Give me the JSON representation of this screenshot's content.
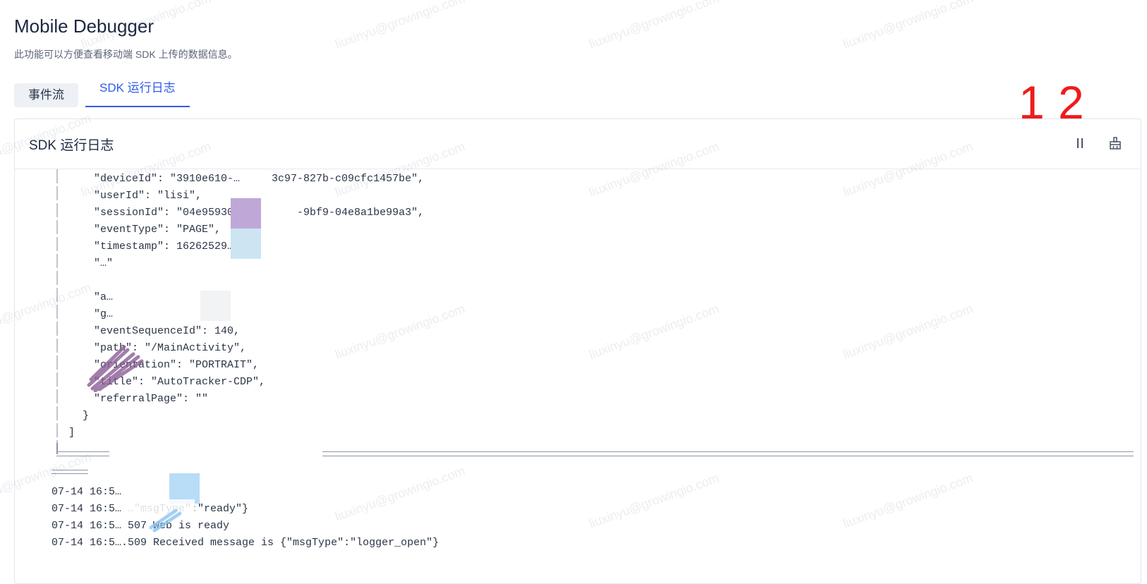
{
  "page": {
    "title": "Mobile Debugger",
    "description": "此功能可以方便查看移动端 SDK 上传的数据信息。"
  },
  "tabs": [
    {
      "label": "事件流",
      "active": false
    },
    {
      "label": "SDK 运行日志",
      "active": true
    }
  ],
  "annotations": [
    "1",
    "2"
  ],
  "panel": {
    "title": "SDK 运行日志",
    "pause_icon": "pause-icon",
    "clear_icon": "clear-broom-icon"
  },
  "json_lines": [
    "\"deviceId\": \"3910e610-…     3c97-827b-c09cfc1457be\",",
    "\"userId\": \"lisi\",",
    "\"sessionId\": \"04e95930-…        -9bf9-04e8a1be99a3\",",
    "\"eventType\": \"PAGE\",",
    "\"timestamp\": 16262529…",
    "\"…\"",
    "",
    "\"a…",
    "\"g…",
    "\"eventSequenceId\": 140,",
    "\"path\": \"/MainActivity\",",
    "\"orientation\": \"PORTRAIT\",",
    "\"title\": \"AutoTracker-CDP\",",
    "\"referralPage\": \"\"",
    "}",
    "]"
  ],
  "log_lines": [
    "07-14 16:5…",
    "07-14 16:5… …\"msgType\":\"ready\"}",
    "07-14 16:5… 507 Web is ready",
    "07-14 16:5….509 Received message is {\"msgType\":\"logger_open\"}"
  ],
  "watermark": "liuxinyu@growingio.com",
  "colors": {
    "accent": "#2f5bea",
    "annotation": "#ee1c1c"
  }
}
